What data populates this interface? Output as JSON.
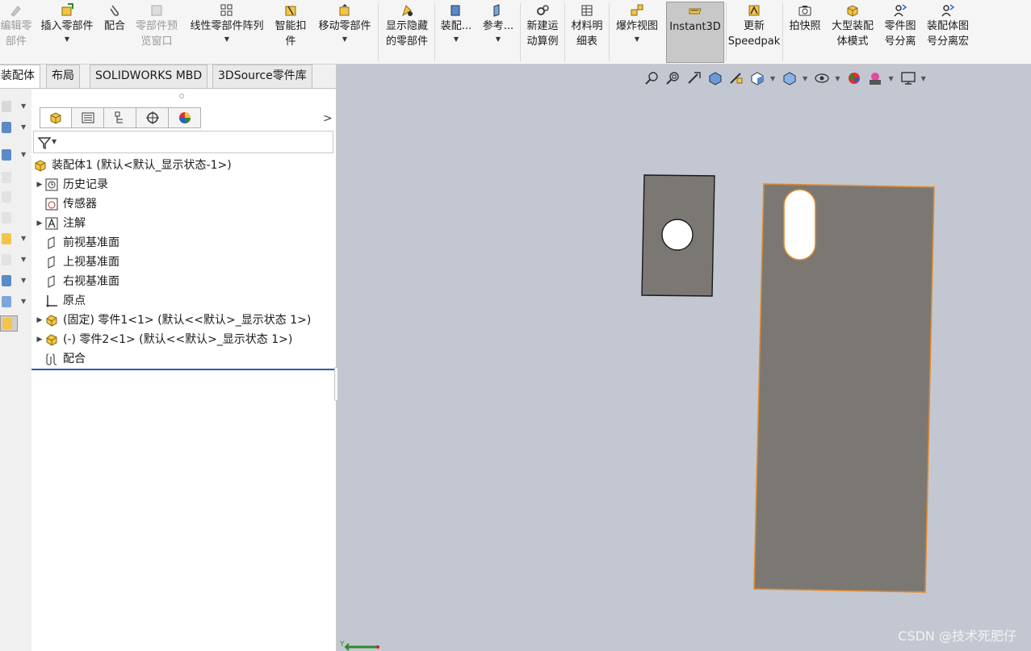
{
  "ribbon": {
    "buttons": [
      {
        "id": "edit-component",
        "label": "编辑零\n部件",
        "disabled": true
      },
      {
        "id": "insert-component",
        "label": "插入零部件"
      },
      {
        "id": "mate",
        "label": "配合"
      },
      {
        "id": "preview-window",
        "label": "零部件预\n览窗口",
        "disabled": true
      },
      {
        "id": "linear-pattern",
        "label": "线性零部件阵列"
      },
      {
        "id": "smart-fasteners",
        "label": "智能扣\n件"
      },
      {
        "id": "move-component",
        "label": "移动零部件"
      },
      {
        "id": "show-hide",
        "label": "显示隐藏\n的零部件"
      },
      {
        "id": "assembly-features",
        "label": "装配..."
      },
      {
        "id": "reference-geometry",
        "label": "参考..."
      },
      {
        "id": "new-motion-study",
        "label": "新建运\n动算例"
      },
      {
        "id": "bom",
        "label": "材料明\n细表"
      },
      {
        "id": "exploded-view",
        "label": "爆炸视图"
      },
      {
        "id": "instant3d",
        "label": "Instant3D"
      },
      {
        "id": "update-speedpak",
        "label": "更新\nSpeedpak"
      },
      {
        "id": "take-snapshot",
        "label": "拍快照"
      },
      {
        "id": "large-assembly",
        "label": "大型装配\n体模式"
      },
      {
        "id": "part-drawing-split",
        "label": "零件图\n号分离"
      },
      {
        "id": "assembly-drawing-split",
        "label": "装配体图\n号分离宏"
      }
    ]
  },
  "tabs": [
    "装配体",
    "布局",
    "SOLIDWORKS MBD",
    "3DSource零件库"
  ],
  "tree": {
    "root": "装配体1  (默认<默认_显示状态-1>)",
    "items": [
      "历史记录",
      "传感器",
      "注解",
      "前视基准面",
      "上视基准面",
      "右视基准面",
      "原点",
      "(固定) 零件1<1> (默认<<默认>_显示状态 1>)",
      "(-) 零件2<1> (默认<<默认>_显示状态 1>)",
      "配合"
    ]
  },
  "viewport": {
    "background": "#c3c7d1",
    "part_color": "#7b7874",
    "selection_color": "#e08a2c",
    "axis_label": "Y"
  },
  "watermark": "CSDN @技术死肥仔"
}
